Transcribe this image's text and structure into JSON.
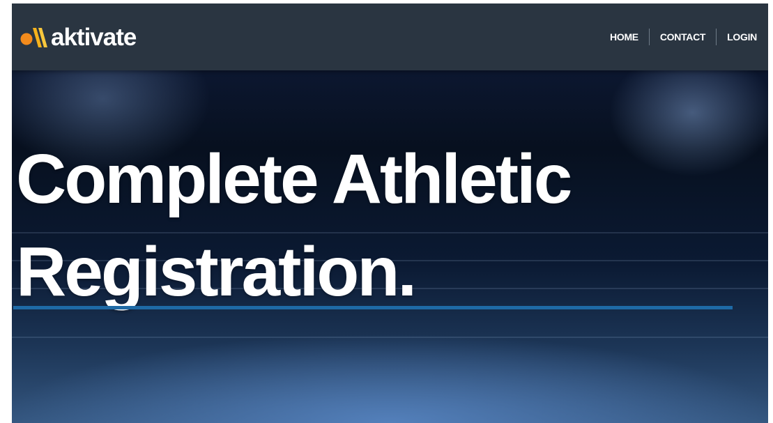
{
  "brand": {
    "name": "aktivate",
    "mark_colors": {
      "dot": "#f38b1c",
      "slash_1": "#f5b21c",
      "slash_2": "#f7c73c"
    }
  },
  "nav": {
    "items": [
      {
        "label": "HOME"
      },
      {
        "label": "CONTACT"
      },
      {
        "label": "LOGIN"
      }
    ]
  },
  "hero": {
    "title_line_1": "Complete Athletic",
    "title_line_2": "Registration.",
    "rule_color": "#1e6aa6"
  },
  "colors": {
    "navbar_bg": "#2a3541",
    "hero_dark": "#07101f",
    "hero_field": "#34567f"
  }
}
